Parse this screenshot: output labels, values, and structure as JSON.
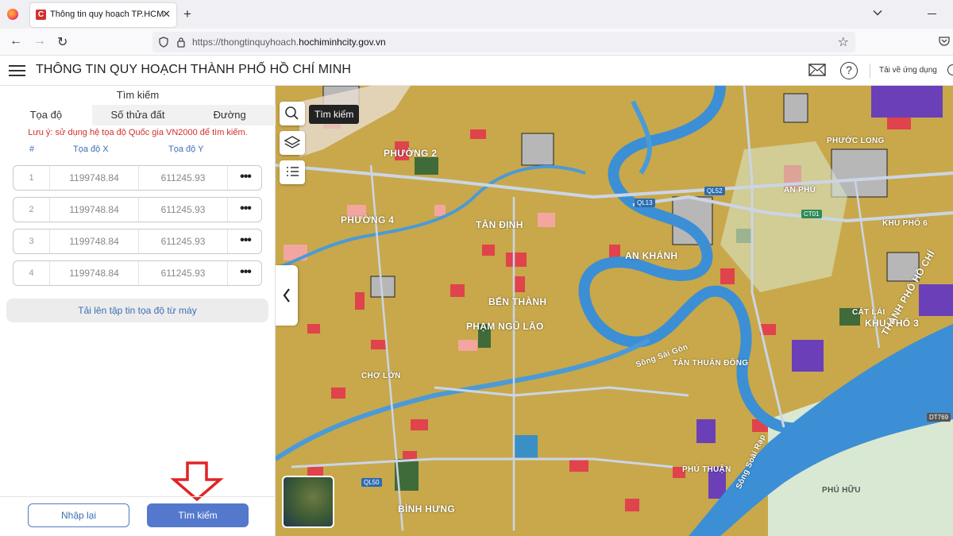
{
  "browser": {
    "tab_title": "Thông tin quy hoạch TP.HCM",
    "tab_favicon": "C",
    "url_prefix": "https://thongtinquyhoach.",
    "url_domain": "hochiminhcity.gov.vn"
  },
  "header": {
    "title": "THÔNG TIN QUY HOẠCH THÀNH PHỐ HỒ CHÍ MINH",
    "help_label": "?",
    "download_app": "Tải về ứng dụng"
  },
  "panel": {
    "title": "Tìm kiếm",
    "tabs": [
      {
        "label": "Tọa độ",
        "active": true
      },
      {
        "label": "Số thửa đất",
        "active": false
      },
      {
        "label": "Đường",
        "active": false
      }
    ],
    "note": "Lưu ý: sử dụng hệ tọa độ Quốc gia VN2000 để tìm kiếm.",
    "columns": {
      "index": "#",
      "x": "Tọa độ X",
      "y": "Tọa độ Y"
    },
    "rows": [
      {
        "index": "1",
        "x": "1199748.84",
        "y": "611245.93",
        "more": "•••"
      },
      {
        "index": "2",
        "x": "1199748.84",
        "y": "611245.93",
        "more": "•••"
      },
      {
        "index": "3",
        "x": "1199748.84",
        "y": "611245.93",
        "more": "•••"
      },
      {
        "index": "4",
        "x": "1199748.84",
        "y": "611245.93",
        "more": "•••"
      }
    ],
    "upload_label": "Tải lên tập tin tọa độ từ máy",
    "reset_label": "Nhập lại",
    "search_label": "Tìm kiếm"
  },
  "map": {
    "search_tooltip": "Tìm kiếm",
    "labels": {
      "phuong_2": "PHƯỜNG 2",
      "phuong_4": "PHƯỜNG 4",
      "tan_dinh": "TÂN ĐỊNH",
      "ben_thanh": "BẾN THÀNH",
      "pham_ngu_lao": "PHẠM NGŨ LÃO",
      "an_khanh": "AN KHÁNH",
      "khu_pho_3": "KHU PHỐ 3",
      "thu_thiem_city": "THÀNH PHỐ HỒ CHÍ",
      "cat_lai": "CÁT LÁI",
      "an_phu": "AN PHÚ",
      "khu_pho_6": "KHU PHỐ 6",
      "phuoc_long": "PHƯỚC LONG",
      "binh_hung": "BÌNH HƯNG",
      "phu_thuan": "PHÚ THUẬN",
      "phu_huu": "PHÚ HỮU",
      "tan_thuan_dong": "TÂN THUẬN ĐÔNG",
      "song_sai_gon": "Sông Sài Gòn",
      "song_soai_rap": "Sông Soài Rạp",
      "cho_lon": "CHỢ LỚN"
    },
    "roads": {
      "ql52": "QL52",
      "ql13": "QL13",
      "ct01": "CT01",
      "dt769": "DT769",
      "ql50": "QL50"
    },
    "colors": {
      "residential": "#c8a84a",
      "commercial": "#e0434b",
      "water": "#3c8fd4",
      "park": "#3f6b3a",
      "institutional": "#6b3fb8",
      "infrastructure": "#b7b7b7"
    }
  }
}
